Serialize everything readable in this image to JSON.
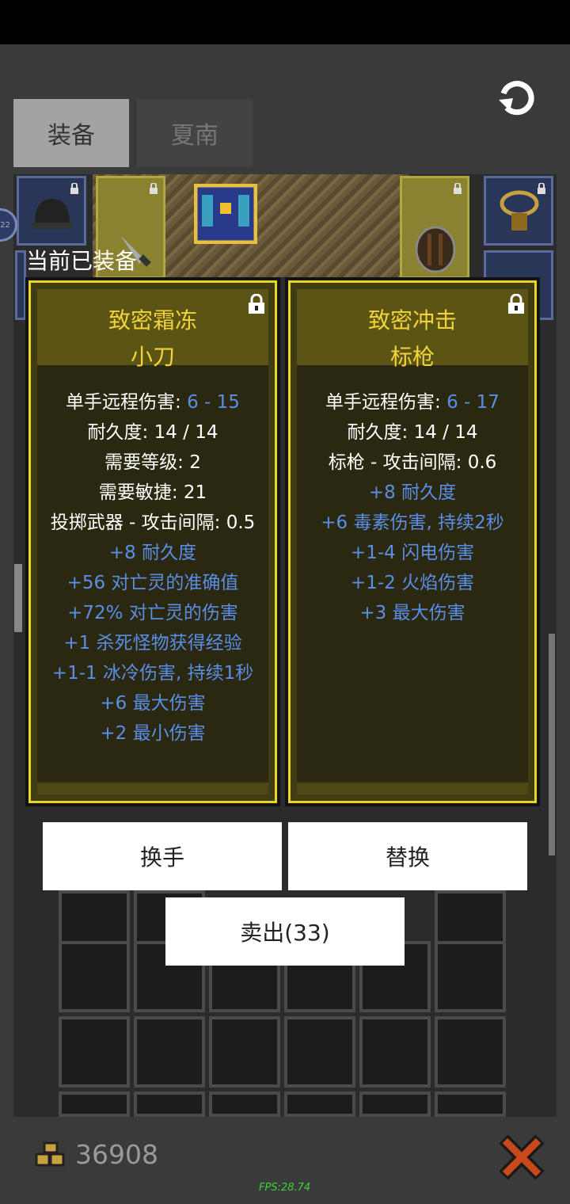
{
  "tabs": [
    {
      "label": "装备",
      "active": true
    },
    {
      "label": "夏南",
      "active": false
    }
  ],
  "equipped_label": "当前已装备",
  "badge_level": "22",
  "cards": [
    {
      "title_line1": "致密霜冻",
      "title_line2": "小刀",
      "lines": [
        {
          "label": "单手远程伤害: ",
          "value": "6 - 15"
        },
        {
          "label": "耐久度: 14 / 14"
        },
        {
          "label": "需要等级: 2"
        },
        {
          "label": "需要敏捷: 21"
        },
        {
          "label": "投掷武器 - 攻击间隔: 0.5"
        },
        {
          "label": "+8 耐久度",
          "magic": true
        },
        {
          "label": "+56 对亡灵的准确值",
          "magic": true
        },
        {
          "label": "+72% 对亡灵的伤害",
          "magic": true
        },
        {
          "label": "+1 杀死怪物获得经验",
          "magic": true
        },
        {
          "label": "+1-1 冰冷伤害, 持续1秒",
          "magic": true
        },
        {
          "label": "+6 最大伤害",
          "magic": true
        },
        {
          "label": "+2 最小伤害",
          "magic": true
        }
      ]
    },
    {
      "title_line1": "致密冲击",
      "title_line2": "标枪",
      "lines": [
        {
          "label": "单手远程伤害: ",
          "value": "6 - 17"
        },
        {
          "label": "耐久度: 14 / 14"
        },
        {
          "label": "标枪 - 攻击间隔: 0.6"
        },
        {
          "label": "+8 耐久度",
          "magic": true
        },
        {
          "label": "+6 毒素伤害, 持续2秒",
          "magic": true
        },
        {
          "label": "+1-4 闪电伤害",
          "magic": true
        },
        {
          "label": "+1-2 火焰伤害",
          "magic": true
        },
        {
          "label": "+3 最大伤害",
          "magic": true
        }
      ]
    }
  ],
  "buttons": {
    "swap_hands": "换手",
    "replace": "替换",
    "sell": "卖出(33)"
  },
  "gold": "36908",
  "fps": "FPS:28.74",
  "colors": {
    "title": "#f2d43a",
    "magic": "#5b8ee6",
    "frame": "#e8d42a"
  }
}
